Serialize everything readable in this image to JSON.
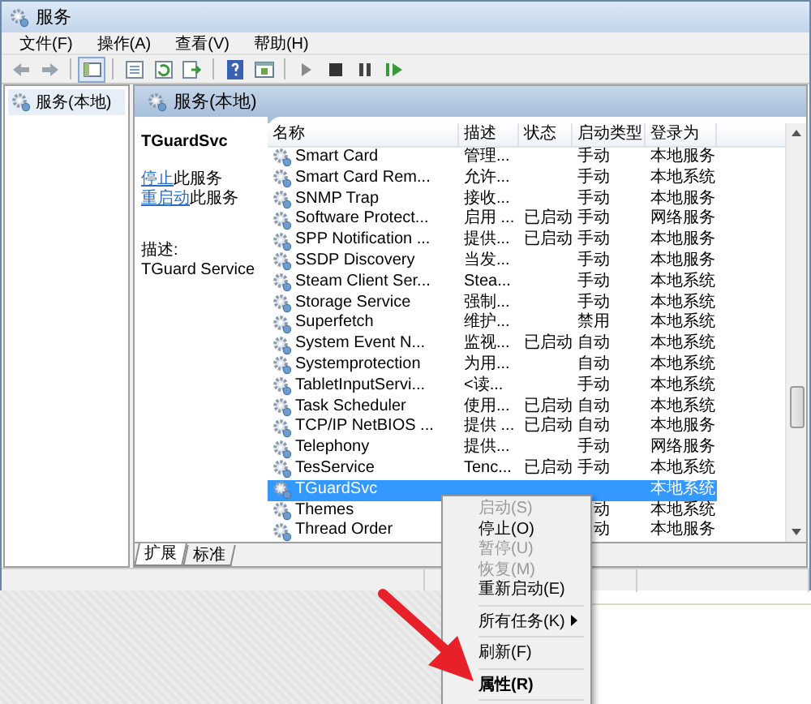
{
  "window": {
    "title": "服务"
  },
  "menu": [
    "文件(F)",
    "操作(A)",
    "查看(V)",
    "帮助(H)"
  ],
  "tree": {
    "items": [
      {
        "label": "服务(本地)",
        "selected": true
      }
    ]
  },
  "pane": {
    "title": "服务(本地)"
  },
  "details": {
    "service_name": "TGuardSvc",
    "actions": [
      {
        "link": "停止",
        "text": "此服务"
      },
      {
        "link": "重启动",
        "text": "此服务"
      }
    ],
    "description_label": "描述:",
    "description": "TGuard Service"
  },
  "table": {
    "columns": [
      "名称",
      "描述",
      "状态",
      "启动类型",
      "登录为"
    ],
    "rows": [
      {
        "name": "Smart Card",
        "description": "管理...",
        "status": "",
        "startup": "手动",
        "logon": "本地服务",
        "selected": false
      },
      {
        "name": "Smart Card Rem...",
        "description": "允许...",
        "status": "",
        "startup": "手动",
        "logon": "本地系统",
        "selected": false
      },
      {
        "name": "SNMP Trap",
        "description": "接收...",
        "status": "",
        "startup": "手动",
        "logon": "本地服务",
        "selected": false
      },
      {
        "name": "Software Protect...",
        "description": "启用 ...",
        "status": "已启动",
        "startup": "手动",
        "logon": "网络服务",
        "selected": false
      },
      {
        "name": "SPP Notification ...",
        "description": "提供...",
        "status": "已启动",
        "startup": "手动",
        "logon": "本地服务",
        "selected": false
      },
      {
        "name": "SSDP Discovery",
        "description": "当发...",
        "status": "",
        "startup": "手动",
        "logon": "本地服务",
        "selected": false
      },
      {
        "name": "Steam Client Ser...",
        "description": "Stea...",
        "status": "",
        "startup": "手动",
        "logon": "本地系统",
        "selected": false
      },
      {
        "name": "Storage Service",
        "description": "强制...",
        "status": "",
        "startup": "手动",
        "logon": "本地系统",
        "selected": false
      },
      {
        "name": "Superfetch",
        "description": "维护...",
        "status": "",
        "startup": "禁用",
        "logon": "本地系统",
        "selected": false
      },
      {
        "name": "System Event N...",
        "description": "监视...",
        "status": "已启动",
        "startup": "自动",
        "logon": "本地系统",
        "selected": false
      },
      {
        "name": "Systemprotection",
        "description": "为用...",
        "status": "",
        "startup": "自动",
        "logon": "本地系统",
        "selected": false
      },
      {
        "name": "TabletInputServi...",
        "description": "<读...",
        "status": "",
        "startup": "手动",
        "logon": "本地系统",
        "selected": false
      },
      {
        "name": "Task Scheduler",
        "description": "使用...",
        "status": "已启动",
        "startup": "自动",
        "logon": "本地系统",
        "selected": false
      },
      {
        "name": "TCP/IP NetBIOS ...",
        "description": "提供 ...",
        "status": "已启动",
        "startup": "自动",
        "logon": "本地服务",
        "selected": false
      },
      {
        "name": "Telephony",
        "description": "提供...",
        "status": "",
        "startup": "手动",
        "logon": "网络服务",
        "selected": false
      },
      {
        "name": "TesService",
        "description": "Tenc...",
        "status": "已启动",
        "startup": "手动",
        "logon": "本地系统",
        "selected": false
      },
      {
        "name": "TGuardSvc",
        "description": "",
        "status": "",
        "startup": "",
        "logon": "本地系统",
        "selected": true
      },
      {
        "name": "Themes",
        "description": "",
        "status": "",
        "startup": "动",
        "logon": "本地系统",
        "selected": false
      },
      {
        "name": "Thread Order",
        "description": "",
        "status": "",
        "startup": "动",
        "logon": "本地服务",
        "selected": false
      }
    ]
  },
  "tabs": [
    {
      "label": "扩展",
      "selected": true
    },
    {
      "label": "标准",
      "selected": false
    }
  ],
  "context_menu": {
    "items": [
      {
        "kind": "item",
        "label": "启动(S)",
        "disabled": true,
        "default": false
      },
      {
        "kind": "item",
        "label": "停止(O)",
        "disabled": false,
        "default": false
      },
      {
        "kind": "item",
        "label": "暂停(U)",
        "disabled": true,
        "default": false
      },
      {
        "kind": "item",
        "label": "恢复(M)",
        "disabled": true,
        "default": false
      },
      {
        "kind": "item",
        "label": "重新启动(E)",
        "disabled": false,
        "default": false
      },
      {
        "kind": "separator"
      },
      {
        "kind": "submenu",
        "label": "所有任务(K)",
        "disabled": false,
        "default": false
      },
      {
        "kind": "separator"
      },
      {
        "kind": "item",
        "label": "刷新(F)",
        "disabled": false,
        "default": false
      },
      {
        "kind": "separator"
      },
      {
        "kind": "item",
        "label": "属性(R)",
        "disabled": false,
        "default": true
      },
      {
        "kind": "separator"
      }
    ]
  }
}
